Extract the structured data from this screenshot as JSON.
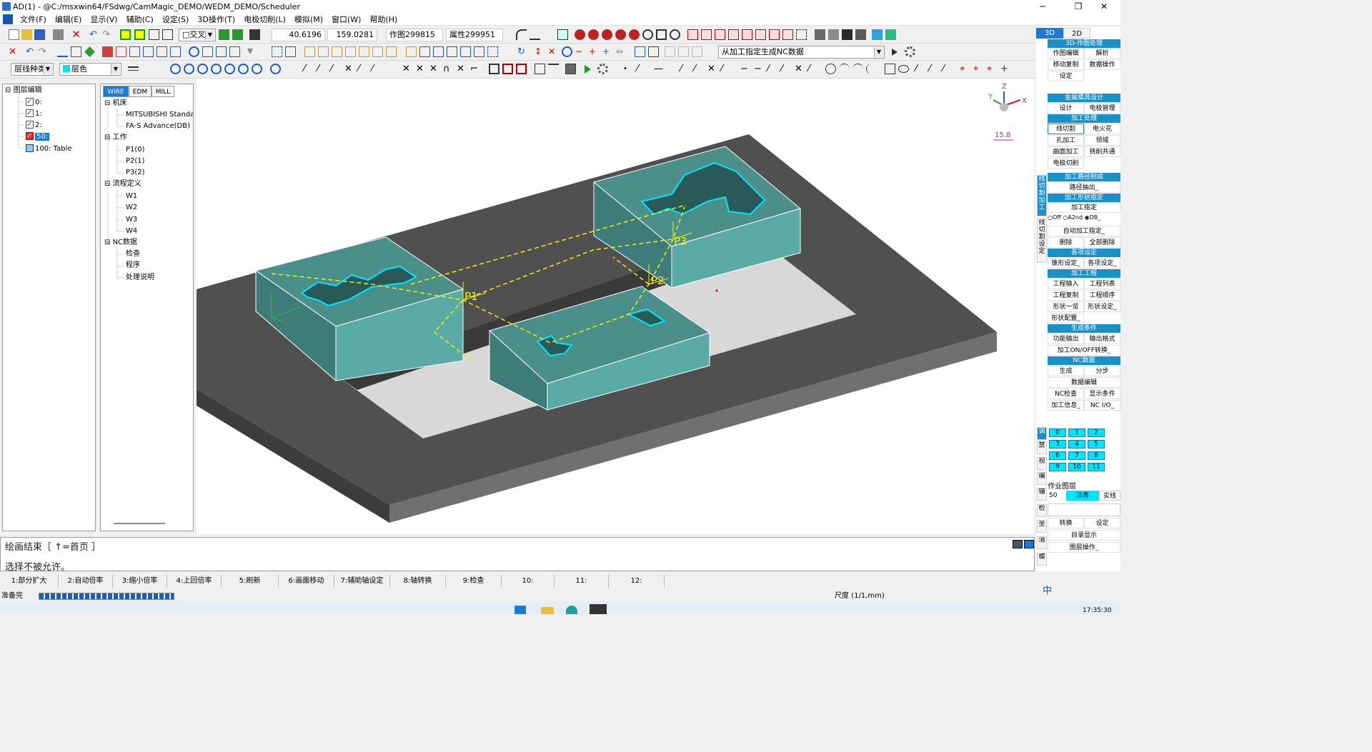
{
  "window": {
    "title": "AD(1) - @C:/msxwin64/FSdwg/CamMagic_DEMO/WEDM_DEMO/Scheduler",
    "minimize": "─",
    "maximize": "❐",
    "close": "✕"
  },
  "menu": [
    "文件(F)",
    "编辑(E)",
    "显示(V)",
    "辅助(C)",
    "设定(S)",
    "3D操作(T)",
    "电极切削(L)",
    "模拟(M)",
    "窗口(W)",
    "帮助(H)"
  ],
  "toolbar1": {
    "mode_select": "□交叉",
    "coord_x": "40.6196",
    "coord_y": "159.0281",
    "draw_count": "作图299815",
    "attr_count": "属性299951"
  },
  "toolbar2": {
    "cnc_select": "从加工指定生成NC数据"
  },
  "toolbar3": {
    "layer_type": "层线种类",
    "layer_color": "层色"
  },
  "layer_panel": {
    "root": "图层编辑",
    "layers": [
      {
        "label": "0:",
        "state": "checked"
      },
      {
        "label": "1:",
        "state": "checked"
      },
      {
        "label": "2:",
        "state": "checked"
      },
      {
        "label": "50:",
        "state": "active"
      },
      {
        "label": "100: Table",
        "state": "table"
      }
    ]
  },
  "process_panel": {
    "tabs": [
      "WIRE",
      "EDM",
      "MILL"
    ],
    "tree": [
      {
        "label": "机床",
        "level": 0,
        "toggle": "⊟"
      },
      {
        "label": "MITSUBISHI Standard",
        "level": 1
      },
      {
        "label": "FA-S Advance(DB)",
        "level": 1
      },
      {
        "label": "工作",
        "level": 0,
        "toggle": "⊟"
      },
      {
        "label": "P1(0)",
        "level": 1
      },
      {
        "label": "P2(1)",
        "level": 1
      },
      {
        "label": "P3(2)",
        "level": 1
      },
      {
        "label": "流程定义",
        "level": 0,
        "toggle": "⊟"
      },
      {
        "label": "W1",
        "level": 1
      },
      {
        "label": "W2",
        "level": 1
      },
      {
        "label": "W3",
        "level": 1
      },
      {
        "label": "W4",
        "level": 1
      },
      {
        "label": "NC数据",
        "level": 0,
        "toggle": "⊟"
      },
      {
        "label": "检查",
        "level": 1
      },
      {
        "label": "程序",
        "level": 1
      },
      {
        "label": "处理说明",
        "level": 1
      }
    ]
  },
  "viewport": {
    "labels": {
      "p1": "P1",
      "p2": "P2",
      "p3": "P3",
      "scale": "15.8",
      "axis_x": "X",
      "axis_y": "Y",
      "axis_z": "Z"
    }
  },
  "command": {
    "line1": "绘画结束［ ↑=首页 ］",
    "line2": "选择不被允许。"
  },
  "fkeys": [
    "1:部分扩大",
    "2:自动倍率",
    "3:缩小倍率",
    "4:上回倍率",
    "5:刷新",
    "6:画面移动",
    "7:辅助轴设定",
    "8:轴转换",
    "9:检查",
    "10:",
    "11:",
    "12:"
  ],
  "status": {
    "ready": "准备完",
    "scale": "尺度 (1/1,mm)",
    "progress": 1.0
  },
  "taskbar": {
    "time": "17:35:30",
    "ime": "中"
  },
  "right_panel": {
    "tabs": [
      "3D",
      "2D"
    ],
    "vtabs": [
      "线切割加工",
      "线切割设定",
      "调",
      "禁",
      "视",
      "编",
      "辅",
      "检",
      "坐",
      "消",
      "模"
    ],
    "headers": [
      "3D-作图处理",
      "金属模具设计",
      "加工处理",
      "加工路径制成",
      "加工形状指定",
      "各项设定",
      "加工工程",
      "生成条件",
      "NC数据"
    ],
    "btn_3d": [
      "作图编辑",
      "解析",
      "移动复制",
      "数据操作",
      "设定"
    ],
    "btn_mold": [
      "设计",
      "电极管理"
    ],
    "btn_proc": [
      "线切割",
      "电火花",
      "孔加工",
      "领域",
      "曲面加工",
      "铣削共通",
      "电极切削"
    ],
    "path_extract": "路径抽出_",
    "shape_spec": "加工指定",
    "radios": [
      "Off",
      "A2nd",
      "DB_"
    ],
    "auto_spec": "自动加工指定_",
    "del": "删除",
    "del_all": "全部删除",
    "setting_btns": [
      "锥形设定_",
      "各项设定_"
    ],
    "process_btns": [
      "工程输入",
      "工程列表",
      "工程复制",
      "工程顺序",
      "形状一览",
      "形状设定_",
      "形状配置_"
    ],
    "cond_btns": [
      "功能输出",
      "输出格式",
      "加工ON/OFF转换_"
    ],
    "nc_btns": [
      "生成",
      "分步",
      "数据编辑",
      "NC检查",
      "显示条件",
      "加工信息_",
      "NC I/O_"
    ],
    "numbers": [
      "0",
      "1",
      "2",
      "3",
      "4",
      "5",
      "6",
      "7",
      "8",
      "9",
      "10",
      "11"
    ],
    "work_layer": "作业图层",
    "layer_num": "50",
    "color_name": "淡青",
    "line_type": "实线",
    "convert": "转换",
    "set": "设定",
    "dir_display": "目录显示",
    "layer_op": "图层操作_"
  }
}
